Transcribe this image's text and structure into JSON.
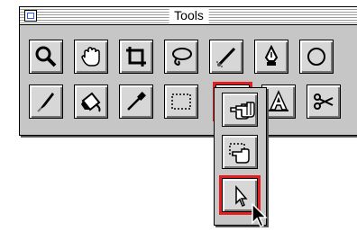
{
  "window": {
    "title": "Tools"
  },
  "tools_row1": [
    "magnify-icon",
    "hand-icon",
    "crop-icon",
    "lasso-icon",
    "brush-icon",
    "pen-icon",
    "ellipse-icon"
  ],
  "tools_row2": [
    "knife-icon",
    "bucket-icon",
    "eyedropper-icon",
    "rectangle-marquee-icon",
    "hand-tool-icon",
    "text-icon",
    "scissors-icon"
  ],
  "flyout": [
    "hand-grab-icon",
    "select-hand-icon",
    "arrow-select-icon"
  ],
  "colors": {
    "highlight": "#e02020",
    "palette_bg": "#c6c6c6",
    "button_bg": "#d7d7d7"
  }
}
